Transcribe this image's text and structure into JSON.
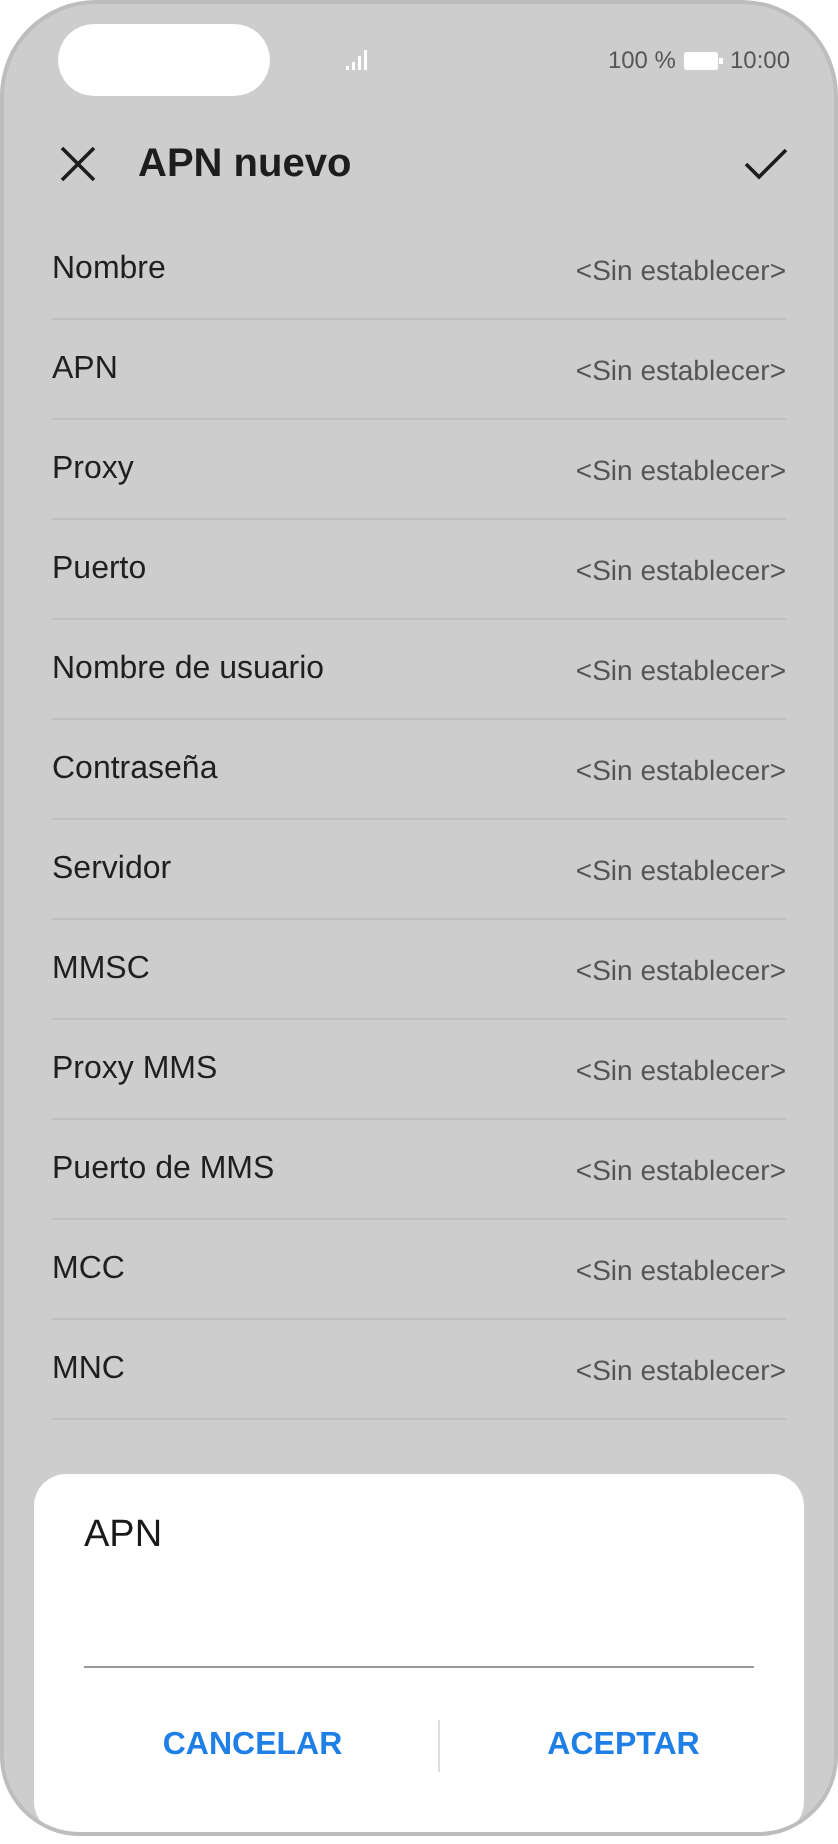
{
  "status_bar": {
    "battery_text": "100 %",
    "time": "10:00"
  },
  "header": {
    "title": "APN nuevo"
  },
  "rows": [
    {
      "label": "Nombre",
      "value": "<Sin establecer>"
    },
    {
      "label": "APN",
      "value": "<Sin establecer>"
    },
    {
      "label": "Proxy",
      "value": "<Sin establecer>"
    },
    {
      "label": "Puerto",
      "value": "<Sin establecer>"
    },
    {
      "label": "Nombre de usuario",
      "value": "<Sin establecer>"
    },
    {
      "label": "Contraseña",
      "value": "<Sin establecer>"
    },
    {
      "label": "Servidor",
      "value": "<Sin establecer>"
    },
    {
      "label": "MMSC",
      "value": "<Sin establecer>"
    },
    {
      "label": "Proxy MMS",
      "value": "<Sin establecer>"
    },
    {
      "label": "Puerto de MMS",
      "value": "<Sin establecer>"
    },
    {
      "label": "MCC",
      "value": "<Sin establecer>"
    },
    {
      "label": "MNC",
      "value": "<Sin establecer>"
    }
  ],
  "dialog": {
    "title": "APN",
    "buttons": [
      "CANCELAR",
      "ACEPTAR"
    ]
  }
}
